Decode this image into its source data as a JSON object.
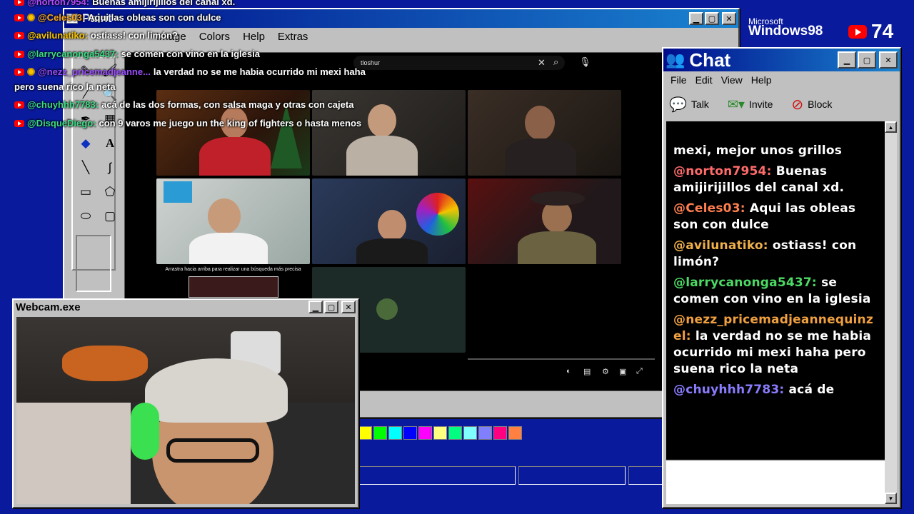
{
  "overlay_chat": [
    {
      "user": "@norton7954:",
      "text": "Buenas amijirijillos del canal xd.",
      "color": "#b44cff",
      "badge": false
    },
    {
      "user": "@Celes03:",
      "text": "Aqui las obleas son con dulce",
      "color": "#f5a623",
      "badge": true
    },
    {
      "user": "@avilunatiko:",
      "text": "ostiass! con limón?",
      "color": "#f5c200",
      "badge": false
    },
    {
      "user": "@larrycanonga5437:",
      "text": "se comen con vino en la iglesia",
      "color": "#3ddc84",
      "badge": false
    },
    {
      "user": "@nezz_pricemadjeanne...",
      "text": "la verdad no se me habia ocurrido mi mexi haha",
      "color": "#9b4dff",
      "badge": true
    },
    {
      "user": "",
      "text": "pero suena rico la neta",
      "color": "#ffffff",
      "badge": false
    },
    {
      "user": "@chuyhhh7783:",
      "text": "acá de las dos formas, con salsa maga y otras con cajeta",
      "color": "#3ddc84",
      "badge": false
    },
    {
      "user": "@DisqueDiego:",
      "text": "con 9 varos me juego un the king of fighters o hasta menos",
      "color": "#3ddc84",
      "badge": false
    }
  ],
  "paint": {
    "title": "Paint",
    "menu": [
      "Image",
      "Colors",
      "Help",
      "Extras"
    ],
    "search_text": "tloshur",
    "tile_caption": "Arrastra hacia arriba para realizar una búsqueda más precisa",
    "palette": [
      "#ffff00",
      "#00ff00",
      "#00ffff",
      "#0000ff",
      "#ff00ff",
      "#ffff80",
      "#00ff80",
      "#80ffff",
      "#8080ff",
      "#ff0080",
      "#ff8040"
    ]
  },
  "chat": {
    "title": "Chat",
    "menu": [
      "File",
      "Edit",
      "View",
      "Help"
    ],
    "toolbar": {
      "talk": "Talk",
      "invite": "Invite",
      "block": "Block"
    },
    "messages": [
      {
        "user": "",
        "text": "mexi, mejor unos grillos",
        "color": "#ff6b6b"
      },
      {
        "user": "@norton7954:",
        "text": "Buenas amijirijillos del canal xd.",
        "color": "#ff6b6b"
      },
      {
        "user": "@Celes03:",
        "text": "Aqui las obleas son con dulce",
        "color": "#ff7f50"
      },
      {
        "user": "@avilunatiko:",
        "text": "ostiass! con limón?",
        "color": "#f0b04c"
      },
      {
        "user": "@larrycanonga5437:",
        "text": "se comen con vino en la iglesia",
        "color": "#4cd964"
      },
      {
        "user": "@nezz_pricemadjeannequinzel:",
        "text": "la verdad no se me habia ocurrido mi mexi haha pero suena rico la neta",
        "color": "#f0a040"
      },
      {
        "user": "@chuyhhh7783:",
        "text": "acá de",
        "color": "#8a7cff"
      }
    ]
  },
  "webcam": {
    "title": "Webcam.exe"
  },
  "brand": {
    "line1": "Microsoft",
    "line2": "Windows98"
  },
  "viewers": "74"
}
